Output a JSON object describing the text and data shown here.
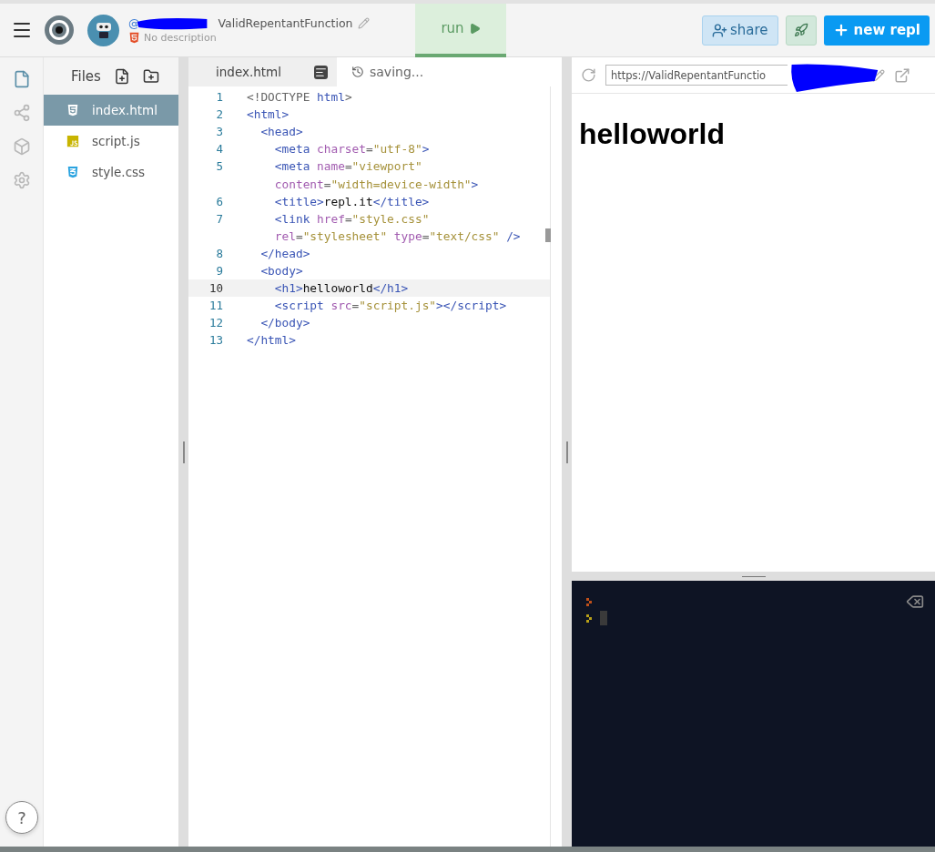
{
  "header": {
    "user_prefix": "@",
    "repl_name": "ValidRepentantFunction",
    "description": "No description",
    "run_button": "run",
    "share_button": "share",
    "new_repl_button": "new repl"
  },
  "sidebar": {
    "items": [
      {
        "kind": "files",
        "selected": true
      },
      {
        "kind": "share",
        "selected": false
      },
      {
        "kind": "packages",
        "selected": false
      },
      {
        "kind": "settings",
        "selected": false
      }
    ]
  },
  "files": {
    "title": "Files",
    "items": [
      {
        "name": "index.html",
        "kind": "html",
        "selected": true
      },
      {
        "name": "script.js",
        "kind": "js",
        "selected": false
      },
      {
        "name": "style.css",
        "kind": "css",
        "selected": false
      }
    ]
  },
  "editor": {
    "tab": "index.html",
    "status": "saving...",
    "lines": [
      {
        "number": "1",
        "active": false,
        "tokens": [
          {
            "kind": "p",
            "text": "<!DOCTYPE "
          },
          {
            "kind": "t",
            "text": "html"
          },
          {
            "kind": "p",
            "text": ">"
          }
        ]
      },
      {
        "number": "2",
        "active": false,
        "tokens": [
          {
            "kind": "t",
            "text": "<html>"
          }
        ]
      },
      {
        "number": "3",
        "active": false,
        "tokens": [
          {
            "kind": "t",
            "text": "  <head>"
          }
        ]
      },
      {
        "number": "4",
        "active": false,
        "tokens": [
          {
            "kind": "t",
            "text": "    <meta "
          },
          {
            "kind": "a",
            "text": "charset"
          },
          {
            "kind": "p",
            "text": "="
          },
          {
            "kind": "s",
            "text": "\"utf-8\""
          },
          {
            "kind": "t",
            "text": ">"
          }
        ]
      },
      {
        "number": "5",
        "active": false,
        "tokens": [
          {
            "kind": "t",
            "text": "    <meta "
          },
          {
            "kind": "a",
            "text": "name"
          },
          {
            "kind": "p",
            "text": "="
          },
          {
            "kind": "s",
            "text": "\"viewport\""
          }
        ]
      },
      {
        "active": false,
        "tokens": [
          {
            "kind": "a",
            "text": "    content"
          },
          {
            "kind": "p",
            "text": "="
          },
          {
            "kind": "s",
            "text": "\"width=device-width\""
          },
          {
            "kind": "t",
            "text": ">"
          }
        ]
      },
      {
        "number": "6",
        "active": false,
        "tokens": [
          {
            "kind": "t",
            "text": "    <title>"
          },
          {
            "kind": "x",
            "text": "repl.it"
          },
          {
            "kind": "t",
            "text": "</title>"
          }
        ]
      },
      {
        "number": "7",
        "active": false,
        "tokens": [
          {
            "kind": "t",
            "text": "    <link "
          },
          {
            "kind": "a",
            "text": "href"
          },
          {
            "kind": "p",
            "text": "="
          },
          {
            "kind": "s",
            "text": "\"style.css\""
          }
        ]
      },
      {
        "active": false,
        "tokens": [
          {
            "kind": "a",
            "text": "    rel"
          },
          {
            "kind": "p",
            "text": "="
          },
          {
            "kind": "s",
            "text": "\"stylesheet\" "
          },
          {
            "kind": "a",
            "text": "type"
          },
          {
            "kind": "p",
            "text": "="
          },
          {
            "kind": "s",
            "text": "\"text/css\""
          },
          {
            "kind": "t",
            "text": " />"
          }
        ]
      },
      {
        "number": "8",
        "active": false,
        "tokens": [
          {
            "kind": "t",
            "text": "  </head>"
          }
        ]
      },
      {
        "number": "9",
        "active": false,
        "tokens": [
          {
            "kind": "t",
            "text": "  <body>"
          }
        ]
      },
      {
        "number": "10",
        "active": true,
        "tokens": [
          {
            "kind": "t",
            "text": "    <h1>"
          },
          {
            "kind": "x",
            "text": "helloworld"
          },
          {
            "kind": "t",
            "text": "</h1>"
          }
        ]
      },
      {
        "number": "11",
        "active": false,
        "tokens": [
          {
            "kind": "t",
            "text": "    <script "
          },
          {
            "kind": "a",
            "text": "src"
          },
          {
            "kind": "p",
            "text": "="
          },
          {
            "kind": "s",
            "text": "\"script.js\""
          },
          {
            "kind": "t",
            "text": "></script>"
          }
        ]
      },
      {
        "number": "12",
        "active": false,
        "tokens": [
          {
            "kind": "t",
            "text": "  </body>"
          }
        ]
      },
      {
        "number": "13",
        "active": false,
        "tokens": [
          {
            "kind": "t",
            "text": "</html>"
          }
        ]
      }
    ]
  },
  "preview": {
    "url": "https://ValidRepentantFunctio",
    "heading": "helloworld"
  },
  "console": {
    "prompts": [
      {
        "color": "#c0501a",
        "cursor": false
      },
      {
        "color": "#b8a018",
        "cursor": true
      }
    ]
  },
  "help_button": "?"
}
